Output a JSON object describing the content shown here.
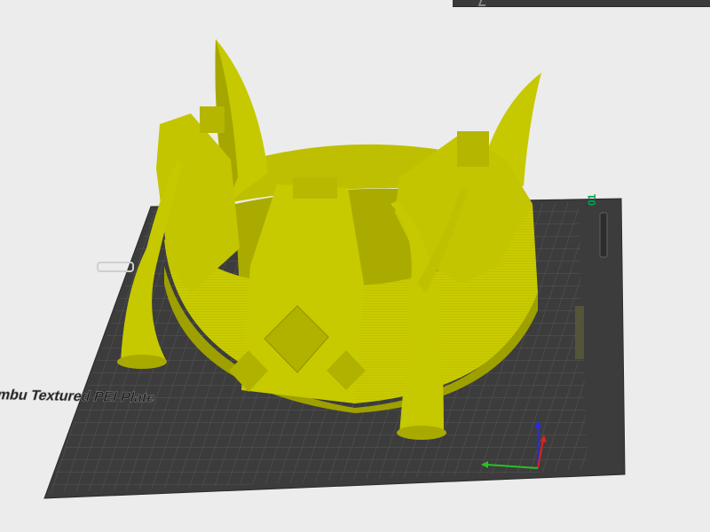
{
  "plate": {
    "label": "Bambu Textured PEI Plate",
    "plate_number": "01",
    "colors": {
      "plate": "#3d3d3d",
      "grid_minor": "#5a5a5a",
      "grid_major": "#7a7a7a",
      "model": "#c6c800",
      "model_shade": "#a4a600",
      "model_dark": "#8d8f00",
      "background": "#ececec",
      "plate_number_color": "#00a651"
    }
  },
  "axes": {
    "x_color": "#27c227",
    "y_color": "#e02020",
    "z_color": "#2b2bd9"
  },
  "icons": {
    "plate_number": "plate-number-label",
    "axis_gizmo": "axis-gizmo-icon"
  }
}
